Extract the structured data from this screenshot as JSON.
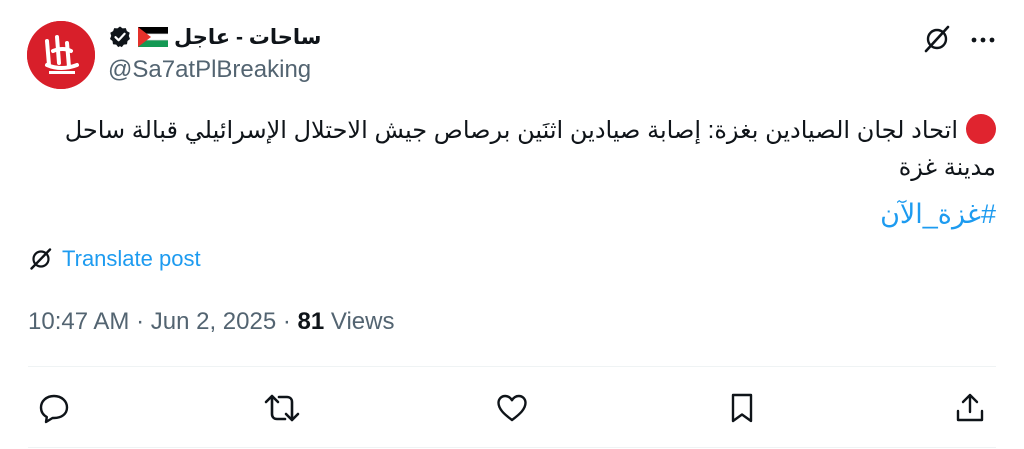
{
  "author": {
    "display_name": "ساحات - عاجل",
    "handle": "@Sa7atPlBreaking",
    "avatar_icon": "sahat-logo",
    "verified_icon": "verified-badge-icon",
    "flag_icon": "palestine-flag-icon"
  },
  "post": {
    "bullet_icon": "red-circle-emoji",
    "text": "اتحاد لجان الصيادين بغزة: إصابة صيادين اثنَين برصاص جيش الاحتلال الإسرائيلي قبالة ساحل مدينة غزة",
    "hashtag": "#غزة_الآن",
    "translate_label": "Translate post",
    "timestamp": "10:47 AM · Jun 2, 2025 · ",
    "views_count": "81",
    "views_label": " Views"
  },
  "actions": [
    "reply-icon",
    "repost-icon",
    "like-icon",
    "bookmark-icon",
    "share-icon"
  ],
  "colors": {
    "accent": "#1d9bf0",
    "text": "#0f1419",
    "muted": "#536471",
    "brand_red": "#d81f2a",
    "divider": "#eff3f4"
  }
}
